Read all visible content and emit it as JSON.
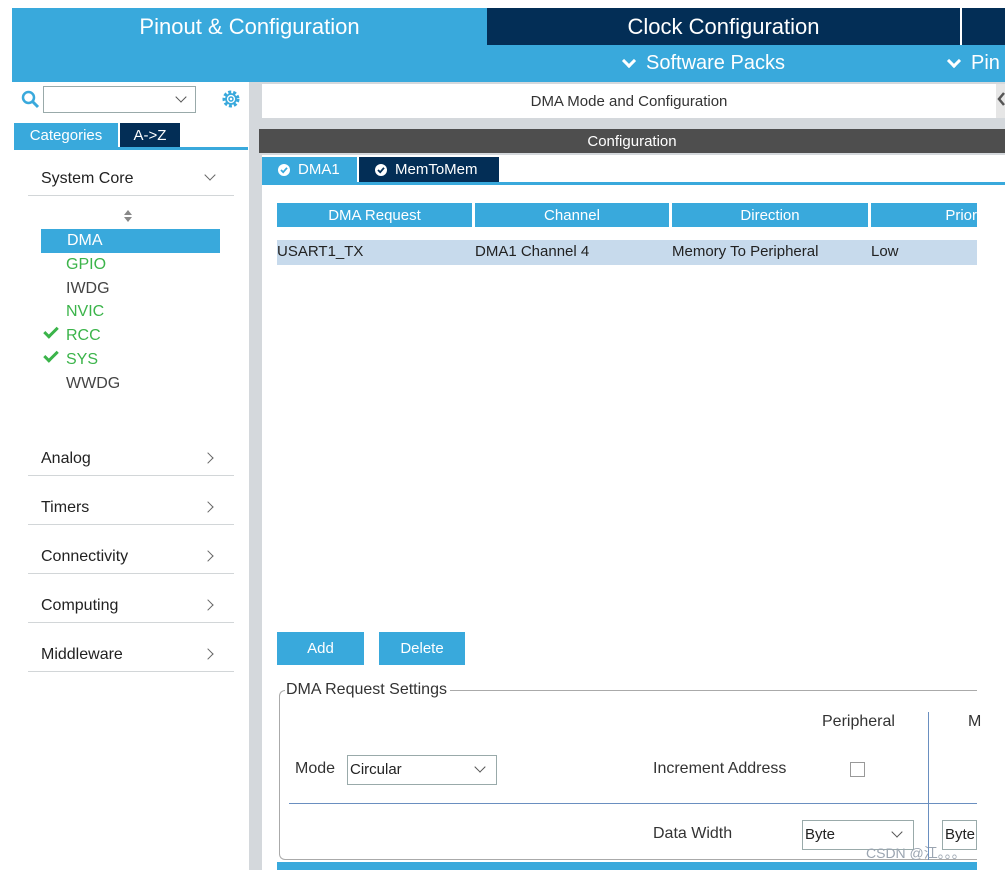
{
  "top_tabs": [
    {
      "label": "Pinout & Configuration",
      "active": true
    },
    {
      "label": "Clock Configuration",
      "active": false
    }
  ],
  "sub_menu": [
    {
      "label": "Software Packs"
    },
    {
      "label": "Pin"
    }
  ],
  "left_panel": {
    "search_value": "",
    "category_tabs": [
      "Categories",
      "A->Z"
    ],
    "groups": [
      {
        "label": "System Core",
        "expanded": true
      },
      {
        "label": "Analog",
        "expanded": false
      },
      {
        "label": "Timers",
        "expanded": false
      },
      {
        "label": "Connectivity",
        "expanded": false
      },
      {
        "label": "Computing",
        "expanded": false
      },
      {
        "label": "Middleware",
        "expanded": false
      }
    ],
    "system_core_items": [
      {
        "label": "DMA",
        "state": "selected",
        "checked": false
      },
      {
        "label": "GPIO",
        "state": "configured",
        "checked": false
      },
      {
        "label": "IWDG",
        "state": "default",
        "checked": false
      },
      {
        "label": "NVIC",
        "state": "configured",
        "checked": false
      },
      {
        "label": "RCC",
        "state": "configured",
        "checked": true
      },
      {
        "label": "SYS",
        "state": "configured",
        "checked": true
      },
      {
        "label": "WWDG",
        "state": "default",
        "checked": false
      }
    ]
  },
  "main": {
    "mode_header": "DMA Mode and Configuration",
    "config_header": "Configuration",
    "tabs": [
      {
        "label": "DMA1",
        "active": true
      },
      {
        "label": "MemToMem",
        "active": false
      }
    ],
    "table": {
      "columns": [
        "DMA Request",
        "Channel",
        "Direction",
        "Prior"
      ],
      "rows": [
        [
          "USART1_TX",
          "DMA1 Channel 4",
          "Memory To Peripheral",
          "Low"
        ]
      ]
    },
    "buttons": {
      "add": "Add",
      "delete": "Delete"
    },
    "settings": {
      "legend": "DMA Request Settings",
      "peripheral_header": "Peripheral",
      "memory_header_partial": "M",
      "mode_label": "Mode",
      "mode_value": "Circular",
      "increment_label": "Increment Address",
      "increment_checked": false,
      "data_width_label": "Data Width",
      "peripheral_width": "Byte",
      "memory_width": "Byte"
    }
  },
  "watermark": "CSDN @江。。。",
  "colors": {
    "accent": "#39a9dc",
    "dark_navy": "#032e56",
    "configured_green": "#3bb44a",
    "panel_gray": "#d4d8dc",
    "row_highlight": "#c7daec"
  }
}
